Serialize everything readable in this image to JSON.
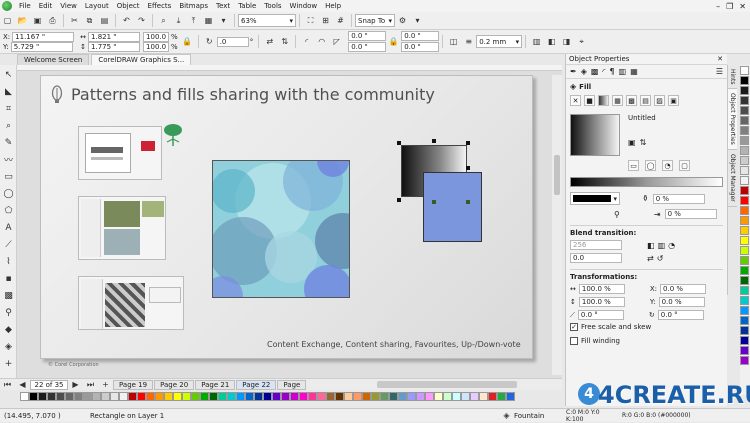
{
  "menu": {
    "items": [
      "File",
      "Edit",
      "View",
      "Layout",
      "Object",
      "Effects",
      "Bitmaps",
      "Text",
      "Table",
      "Tools",
      "Window",
      "Help"
    ]
  },
  "toolbar1": {
    "zoom_value": "63%",
    "snap_label": "Snap To"
  },
  "toolbar2": {
    "x_value": "11.167 \"",
    "y_value": "5.729 \"",
    "w_value": "1.821 \"",
    "h_value": "1.775 \"",
    "sx_value": "100.0",
    "sy_value": "100.0",
    "pct": "%",
    "rotation_value": ".0",
    "deg": "°",
    "c1": "0.0 \"",
    "c2": "0.0 \"",
    "c3": "0.0 \"",
    "c4": "0.0 \"",
    "outline_value": "0.2 mm"
  },
  "doc_tabs": [
    "Welcome Screen",
    "CorelDRAW Graphics S..."
  ],
  "slide": {
    "title": "Patterns and fills sharing with the community",
    "caption": "Content Exchange, Content sharing, Favourites, Up-/Down-vote",
    "copyright": "© Corel Corporation"
  },
  "pages": {
    "counter": "22 of 35",
    "tabs": [
      "Page 19",
      "Page 20",
      "Page 21",
      "Page 22",
      "Page"
    ],
    "active_index": 3
  },
  "status": {
    "coords": "(14.495, 7.070 )",
    "selection": "Rectangle on Layer 1",
    "fill_label": "Fountain",
    "color_info": "C:0 M:0 Y:0 K:100",
    "rgb_info": "R:0 G:0 B:0 (#000000)"
  },
  "panel": {
    "title": "Object Properties",
    "fill_section": "Fill",
    "fill_name": "Untitled",
    "stop_offset": "0 %",
    "blend_title": "Blend transition:",
    "blend_steps": "256",
    "blend_accel": "0.0",
    "transform_title": "Transformations:",
    "tw": "100.0 %",
    "th": "100.0 %",
    "tx": "0.0 %",
    "ty": "0.0 %",
    "skew": "0.0 °",
    "rot": "0.0 °",
    "free_scale_label": "Free scale and skew",
    "fill_winding_label": "Fill winding"
  },
  "dock_tabs": [
    "Hints",
    "Object Properties",
    "Object Manager"
  ],
  "watermark": "4CREATE.RU",
  "colors": {
    "accent_blue": "#7b96dc",
    "pattern_bg": "#8fd0dc",
    "page_bg": "#eeeeee"
  },
  "palette": [
    "#ffffff",
    "#000000",
    "#1a1a1a",
    "#333333",
    "#4d4d4d",
    "#666666",
    "#808080",
    "#999999",
    "#b3b3b3",
    "#cccccc",
    "#e6e6e6",
    "#f2f2f2",
    "#c00000",
    "#ff0000",
    "#ff6600",
    "#ff9900",
    "#ffcc00",
    "#ffff00",
    "#ccff00",
    "#66cc00",
    "#00aa00",
    "#006600",
    "#00cc99",
    "#00cccc",
    "#0099ff",
    "#0066cc",
    "#003399",
    "#000099",
    "#6600cc",
    "#9900cc",
    "#cc00cc",
    "#ff00cc",
    "#ff3399",
    "#ff6699",
    "#996633",
    "#663300",
    "#ffcc99",
    "#ff9966",
    "#cc6600",
    "#999933",
    "#669966",
    "#336666",
    "#6699cc",
    "#9999ff",
    "#cc99ff",
    "#ff99ff",
    "#ffffcc",
    "#ccffcc",
    "#ccffff",
    "#cce6ff",
    "#e6ccff",
    "#ffe6cc",
    "#dd2222",
    "#22aa44",
    "#2266dd"
  ]
}
